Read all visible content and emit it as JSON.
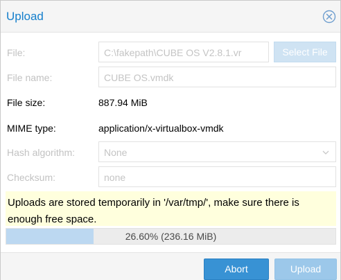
{
  "window": {
    "title": "Upload"
  },
  "form": {
    "file": {
      "label": "File:",
      "value": "C:\\fakepath\\CUBE OS V2.8.1.vr",
      "button": "Select File"
    },
    "file_name": {
      "label": "File name:",
      "value": "CUBE OS.vmdk"
    },
    "file_size": {
      "label": "File size:",
      "value": "887.94 MiB"
    },
    "mime_type": {
      "label": "MIME type:",
      "value": "application/x-virtualbox-vmdk"
    },
    "hash_algorithm": {
      "label": "Hash algorithm:",
      "value": "None"
    },
    "checksum": {
      "label": "Checksum:",
      "placeholder": "none"
    }
  },
  "notice": "Uploads are stored temporarily in '/var/tmp/', make sure there is enough free space.",
  "progress": {
    "fraction": 0.266,
    "text": "26.60% (236.16 MiB)"
  },
  "footer": {
    "abort_label": "Abort",
    "upload_label": "Upload"
  },
  "colors": {
    "accent": "#157fcc",
    "primary_button": "#3892d4",
    "notice_bg": "#ffffdd",
    "progress_fill": "#bcd8f1"
  }
}
